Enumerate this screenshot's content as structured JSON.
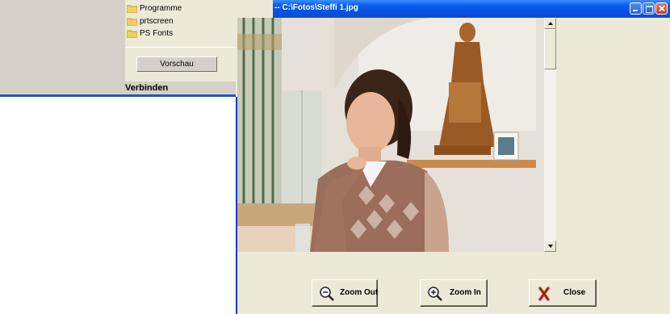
{
  "folder_browser": {
    "items": [
      {
        "label": "Programme",
        "icon": "folder-icon"
      },
      {
        "label": "prtscreen",
        "icon": "folder-icon"
      },
      {
        "label": "PS Fonts",
        "icon": "folder-icon"
      }
    ],
    "preview_button": "Vorschau",
    "connect_label": "Verbinden"
  },
  "viewer": {
    "title": "-- C:\\Fotos\\Steffi 1.jpg",
    "buttons": {
      "zoom_out": "Zoom Out",
      "zoom_in": "Zoom In",
      "close": "Close"
    }
  },
  "colors": {
    "titlebar": "#0a5df0",
    "window_face": "#ece9d8",
    "close_red": "#c9381c"
  }
}
